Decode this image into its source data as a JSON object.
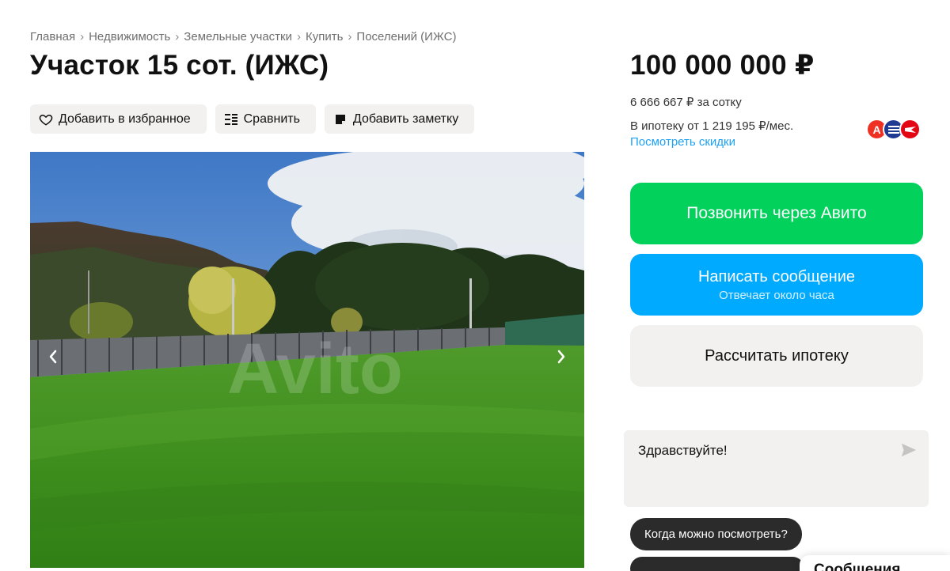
{
  "breadcrumb": [
    "Главная",
    "Недвижимость",
    "Земельные участки",
    "Купить",
    "Поселений (ИЖС)"
  ],
  "breadcrumb_sep": "›",
  "title": "Участок 15 сот. (ИЖС)",
  "actions": {
    "favorite": "Добавить в избранное",
    "compare": "Сравнить",
    "note": "Добавить заметку"
  },
  "photo": {
    "watermark": "Avito",
    "prev_icon": "chevron-left-icon",
    "next_icon": "chevron-right-icon"
  },
  "price": {
    "total": "100 000 000 ₽",
    "per_sotka": "6 666 667 ₽ за сотку",
    "mortgage": "В ипотеку от 1 219 195 ₽/мес.",
    "discounts_link": "Посмотреть скидки"
  },
  "banks": [
    {
      "letter": "А",
      "color": "#ef3124"
    },
    {
      "letter": "",
      "color": "#1f3a93"
    },
    {
      "letter": "",
      "color": "#e30613"
    }
  ],
  "buttons": {
    "call": "Позвонить через Авито",
    "message": "Написать сообщение",
    "message_sub": "Отвечает около часа",
    "mortgage": "Рассчитать ипотеку"
  },
  "chat": {
    "text": "Здравствуйте!"
  },
  "quick_replies": [
    "Когда можно посмотреть?"
  ],
  "messages_tab": "Сообщения",
  "colors": {
    "call_green": "#02d15c",
    "message_blue": "#00aaff",
    "link_blue": "#1da1f2",
    "button_gray": "#f2f1ef"
  }
}
